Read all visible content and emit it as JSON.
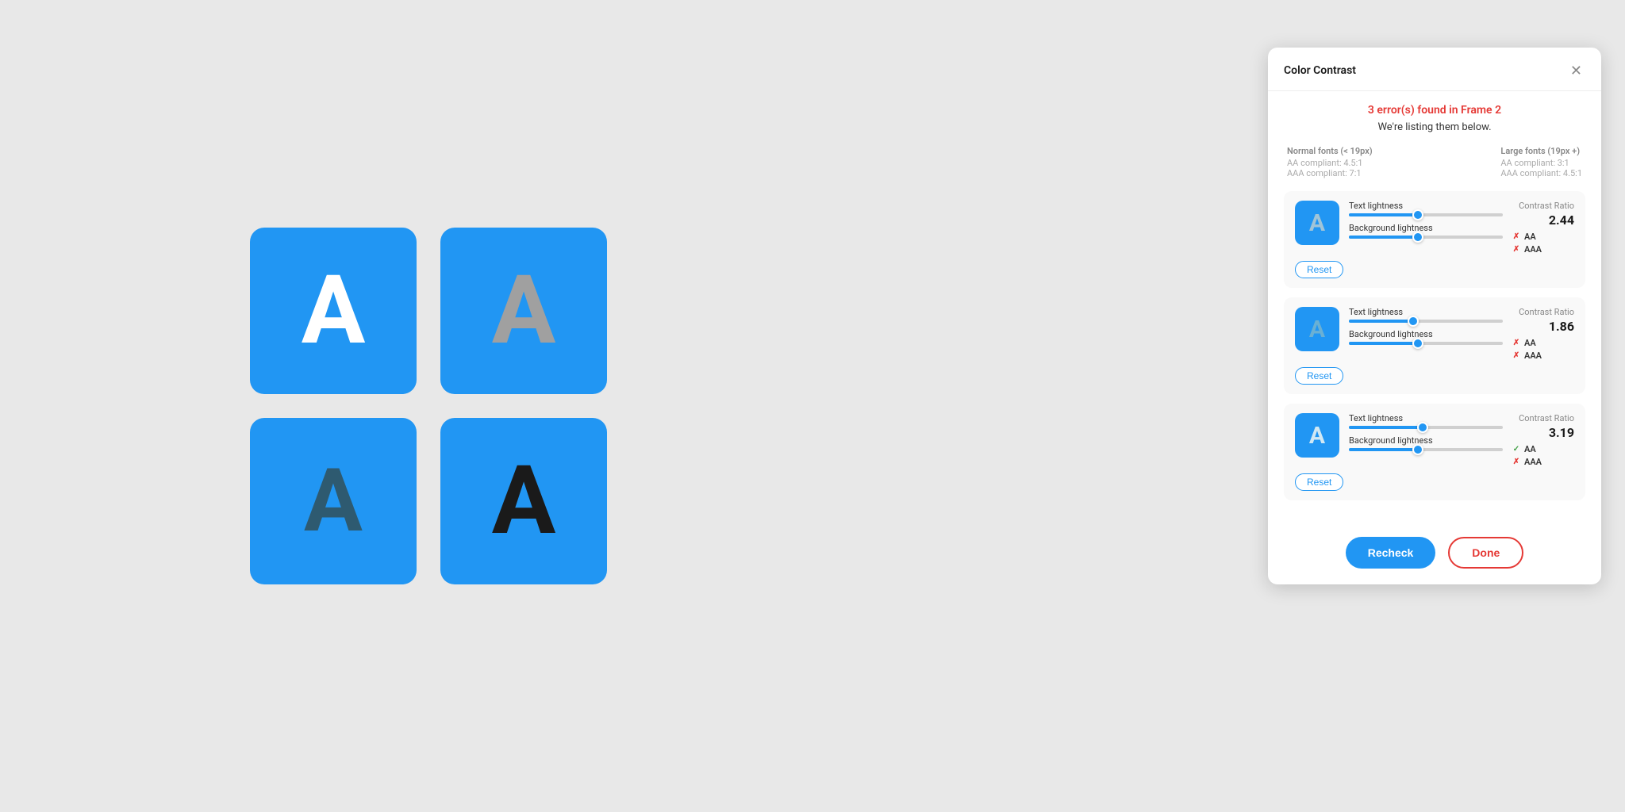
{
  "canvas": {
    "boxes": [
      {
        "id": "box1",
        "letter": "A",
        "text_color_class": "white-text"
      },
      {
        "id": "box2",
        "letter": "A",
        "text_color_class": "gray-text"
      },
      {
        "id": "box3",
        "letter": "A",
        "text_color_class": "dark-blue-text"
      },
      {
        "id": "box4",
        "letter": "A",
        "text_color_class": "black-text"
      }
    ]
  },
  "panel": {
    "title": "Color Contrast",
    "error_title": "3 error(s) found in Frame 2",
    "error_subtitle": "We're listing them below.",
    "compliance": {
      "normal_fonts_label": "Normal fonts (< 19px)",
      "normal_aa": "AA compliant: 4.5:1",
      "normal_aaa": "AAA compliant: 7:1",
      "large_fonts_label": "Large fonts (19px +)",
      "large_aa": "AA compliant: 3:1",
      "large_aaa": "AAA compliant: 4.5:1"
    },
    "items": [
      {
        "id": "item1",
        "letter": "A",
        "text_lightness_label": "Text lightness",
        "text_slider_pct": 45,
        "bg_lightness_label": "Background lightness",
        "bg_slider_pct": 45,
        "ratio_label": "Contrast Ratio",
        "ratio_value": "2.44",
        "aa_pass": false,
        "aaa_pass": false,
        "aa_label": "AA",
        "aaa_label": "AAA",
        "reset_label": "Reset",
        "preview_class": "item1"
      },
      {
        "id": "item2",
        "letter": "A",
        "text_lightness_label": "Text lightness",
        "text_slider_pct": 42,
        "bg_lightness_label": "Background lightness",
        "bg_slider_pct": 45,
        "ratio_label": "Contrast Ratio",
        "ratio_value": "1.86",
        "aa_pass": false,
        "aaa_pass": false,
        "aa_label": "AA",
        "aaa_label": "AAA",
        "reset_label": "Reset",
        "preview_class": "item2"
      },
      {
        "id": "item3",
        "letter": "A",
        "text_lightness_label": "Text lightness",
        "text_slider_pct": 48,
        "bg_lightness_label": "Background lightness",
        "bg_slider_pct": 45,
        "ratio_label": "Contrast Ratio",
        "ratio_value": "3.19",
        "aa_pass": true,
        "aaa_pass": false,
        "aa_label": "AA",
        "aaa_label": "AAA",
        "reset_label": "Reset",
        "preview_class": "item3"
      }
    ],
    "recheck_label": "Recheck",
    "done_label": "Done"
  }
}
